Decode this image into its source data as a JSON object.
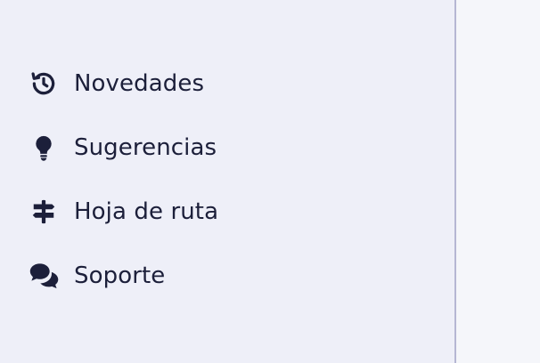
{
  "sidebar": {
    "items": [
      {
        "label": "Novedades",
        "icon": "history-icon"
      },
      {
        "label": "Sugerencias",
        "icon": "lightbulb-icon"
      },
      {
        "label": "Hoja de ruta",
        "icon": "signpost-icon"
      },
      {
        "label": "Soporte",
        "icon": "chat-bubbles-icon"
      }
    ]
  },
  "colors": {
    "sidebar_background": "#eeeff8",
    "main_background": "#f5f6fa",
    "divider": "#b6b7d3",
    "text": "#1c1f3a"
  }
}
